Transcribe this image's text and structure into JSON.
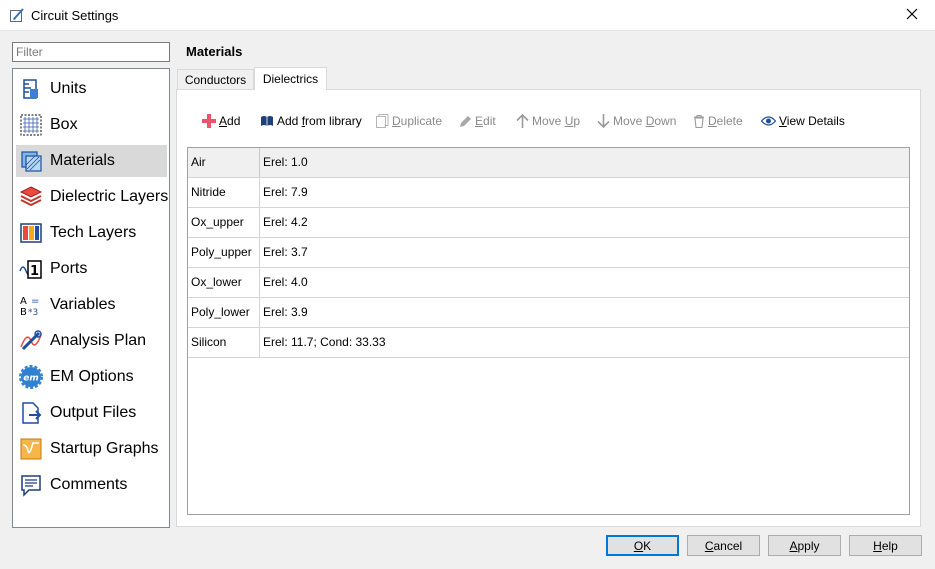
{
  "window": {
    "title": "Circuit Settings",
    "close_icon": "close-icon"
  },
  "filter": {
    "placeholder": "Filter",
    "value": ""
  },
  "nav": {
    "items": [
      {
        "label": "Units",
        "icon": "units-icon"
      },
      {
        "label": "Box",
        "icon": "box-icon"
      },
      {
        "label": "Materials",
        "icon": "materials-icon",
        "selected": true
      },
      {
        "label": "Dielectric Layers",
        "icon": "dielectric-layers-icon"
      },
      {
        "label": "Tech Layers",
        "icon": "tech-layers-icon"
      },
      {
        "label": "Ports",
        "icon": "ports-icon"
      },
      {
        "label": "Variables",
        "icon": "variables-icon"
      },
      {
        "label": "Analysis Plan",
        "icon": "analysis-plan-icon"
      },
      {
        "label": "EM Options",
        "icon": "em-options-icon"
      },
      {
        "label": "Output Files",
        "icon": "output-files-icon"
      },
      {
        "label": "Startup Graphs",
        "icon": "startup-graphs-icon"
      },
      {
        "label": "Comments",
        "icon": "comments-icon"
      }
    ]
  },
  "main": {
    "title": "Materials",
    "tabs": [
      {
        "label": "Conductors",
        "active": false
      },
      {
        "label": "Dielectrics",
        "active": true
      }
    ],
    "toolbar": {
      "add": {
        "underline": "A",
        "rest": "dd",
        "enabled": true
      },
      "add_from_library": {
        "pre": "Add ",
        "underline": "f",
        "rest": "rom library",
        "enabled": true
      },
      "duplicate": {
        "underline": "D",
        "rest": "uplicate",
        "enabled": false
      },
      "edit": {
        "underline": "E",
        "rest": "dit",
        "enabled": false
      },
      "move_up": {
        "pre": "Move ",
        "underline": "U",
        "rest": "p",
        "enabled": false
      },
      "move_down": {
        "pre": "Move ",
        "underline": "D",
        "rest": "own",
        "enabled": false
      },
      "delete": {
        "underline": "D",
        "rest": "elete",
        "enabled": false
      },
      "view_details": {
        "underline": "V",
        "rest": "iew Details",
        "enabled": true
      }
    },
    "dielectrics": [
      {
        "name": "Air",
        "value": "Erel: 1.0"
      },
      {
        "name": "Nitride",
        "value": "Erel: 7.9"
      },
      {
        "name": "Ox_upper",
        "value": "Erel: 4.2"
      },
      {
        "name": "Poly_upper",
        "value": "Erel: 3.7"
      },
      {
        "name": "Ox_lower",
        "value": "Erel: 4.0"
      },
      {
        "name": "Poly_lower",
        "value": "Erel: 3.9"
      },
      {
        "name": "Silicon",
        "value": "Erel: 11.7; Cond: 33.33"
      }
    ]
  },
  "buttons": {
    "ok": {
      "underline": "O",
      "rest": "K"
    },
    "cancel": {
      "underline": "C",
      "rest": "ancel"
    },
    "apply": {
      "underline": "A",
      "rest": "pply"
    },
    "help": {
      "underline": "H",
      "rest": "elp"
    }
  },
  "colors": {
    "accent": "#0078d7",
    "selected_bg": "#d9d9d9",
    "disabled_text": "#8a8a8a"
  }
}
